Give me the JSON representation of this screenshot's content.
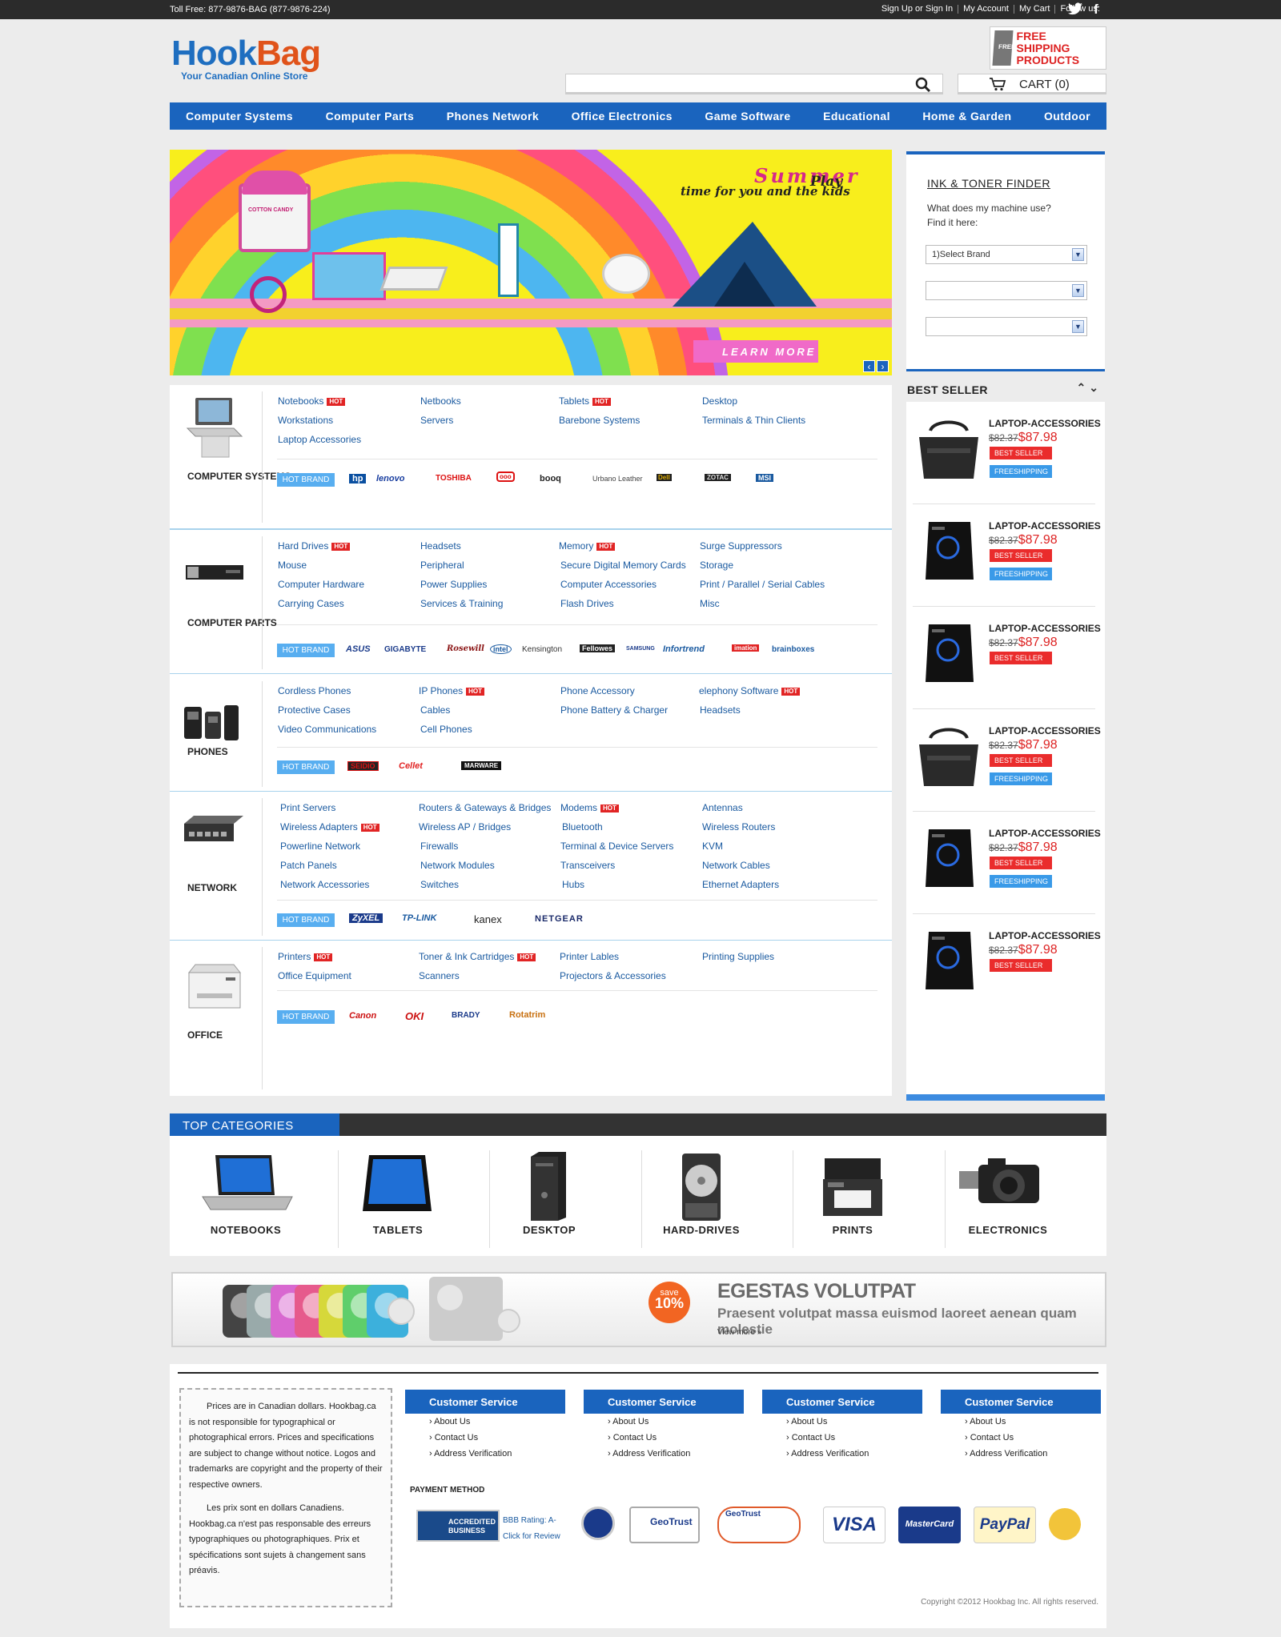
{
  "topbar": {
    "toll_free": "Toll Free: 877-9876-BAG (877-9876-224)",
    "links": [
      "Sign Up or Sign In",
      "My Account",
      "My Cart",
      "Follow us:"
    ],
    "social_icons": [
      "twitter-icon",
      "facebook-icon"
    ]
  },
  "header": {
    "logo_part1": "Hook",
    "logo_part2": "Bag",
    "tagline": "Your Canadian Online Store",
    "free_shipping": "FREE SHIPPING PRODUCTS",
    "free_shipping_box": "FREE",
    "search_placeholder": "",
    "cart_label": "CART (0)"
  },
  "nav": [
    "Computer Systems",
    "Computer Parts",
    "Phones Network",
    "Office Electronics",
    "Game Software",
    "Educational",
    "Home & Garden",
    "Outdoor"
  ],
  "slider": {
    "headline": "Summer",
    "play": "Play",
    "subline": "time for you and the kids",
    "button": "LEARN MORE",
    "cotton_candy_label": "COTTON CANDY"
  },
  "categories": [
    {
      "title": "COMPUTER SYSTEMS",
      "items": [
        {
          "label": "Notebooks",
          "hot": true
        },
        {
          "label": "Netbooks"
        },
        {
          "label": "Tablets",
          "hot": true
        },
        {
          "label": "Desktop"
        },
        {
          "label": "Workstations"
        },
        {
          "label": "Servers"
        },
        {
          "label": "Barebone Systems"
        },
        {
          "label": "Terminals & Thin Clients"
        },
        {
          "label": "Laptop Accessories"
        }
      ],
      "brands": [
        "hp",
        "lenovo",
        "TOSHIBA",
        "ooo",
        "booq",
        "Urbano Leather",
        "Dell",
        "ZOTAC",
        "MSI"
      ]
    },
    {
      "title": "COMPUTER PARTS",
      "items": [
        {
          "label": "Hard Drives",
          "hot": true
        },
        {
          "label": "Headsets"
        },
        {
          "label": "Memory",
          "hot": true
        },
        {
          "label": "Surge Suppressors"
        },
        {
          "label": "Mouse"
        },
        {
          "label": "Peripheral"
        },
        {
          "label": "Secure Digital Memory Cards"
        },
        {
          "label": "Storage"
        },
        {
          "label": "Computer Hardware"
        },
        {
          "label": "Power Supplies"
        },
        {
          "label": "Computer Accessories"
        },
        {
          "label": "Print / Parallel / Serial Cables"
        },
        {
          "label": "Carrying Cases"
        },
        {
          "label": "Services & Training"
        },
        {
          "label": "Flash Drives"
        },
        {
          "label": "Misc"
        }
      ],
      "brands": [
        "ASUS",
        "GIGABYTE",
        "Rosewill",
        "intel",
        "Kensington",
        "Fellowes",
        "SAMSUNG",
        "Infortrend",
        "imation",
        "brainboxes"
      ]
    },
    {
      "title": "PHONES",
      "items": [
        {
          "label": "Cordless Phones"
        },
        {
          "label": "IP Phones",
          "hot": true
        },
        {
          "label": "Phone Accessory"
        },
        {
          "label": "elephony Software",
          "hot": true
        },
        {
          "label": "Protective Cases"
        },
        {
          "label": "Cables"
        },
        {
          "label": "Phone Battery & Charger"
        },
        {
          "label": "Headsets"
        },
        {
          "label": "Video Communications"
        },
        {
          "label": "Cell Phones"
        }
      ],
      "brands": [
        "SEIDIO",
        "Cellet",
        "MARWARE"
      ]
    },
    {
      "title": "NETWORK",
      "items": [
        {
          "label": "Print Servers"
        },
        {
          "label": "Routers & Gateways & Bridges"
        },
        {
          "label": "Modems",
          "hot": true
        },
        {
          "label": "Antennas"
        },
        {
          "label": "Wireless Adapters",
          "hot": true
        },
        {
          "label": "Wireless AP / Bridges"
        },
        {
          "label": "Bluetooth"
        },
        {
          "label": "Wireless Routers"
        },
        {
          "label": "Powerline Network"
        },
        {
          "label": "Firewalls"
        },
        {
          "label": "Terminal & Device Servers"
        },
        {
          "label": "KVM"
        },
        {
          "label": "Patch Panels"
        },
        {
          "label": "Network Modules"
        },
        {
          "label": "Transceivers"
        },
        {
          "label": "Network Cables"
        },
        {
          "label": "Network Accessories"
        },
        {
          "label": "Switches"
        },
        {
          "label": "Hubs"
        },
        {
          "label": "Ethernet Adapters"
        }
      ],
      "brands": [
        "ZyXEL",
        "TP-LINK",
        "kanex",
        "NETGEAR"
      ]
    },
    {
      "title": "OFFICE",
      "items": [
        {
          "label": "Printers",
          "hot": true
        },
        {
          "label": "Toner & Ink Cartridges",
          "hot": true
        },
        {
          "label": "Printer Lables"
        },
        {
          "label": "Printing Supplies"
        },
        {
          "label": "Office Equipment"
        },
        {
          "label": "Scanners"
        },
        {
          "label": "Projectors & Accessories"
        }
      ],
      "brands": [
        "Canon",
        "OKI",
        "BRADY",
        "Rotatrim"
      ]
    }
  ],
  "hot_label": "HOT",
  "hot_brand_label": "HOT BRAND",
  "ink_finder": {
    "title": "INK & TONER FINDER",
    "question": "What does my machine use?",
    "hint": "Find it here:",
    "select1": "1)Select Brand",
    "select2": "",
    "select3": ""
  },
  "best_seller": {
    "title": "BEST SELLER",
    "products": [
      {
        "name": "LAPTOP-ACCESSORIES",
        "old": "$82.37",
        "price": "$87.98",
        "badges": [
          "BEST SELLER",
          "FREESHIPPING"
        ]
      },
      {
        "name": "LAPTOP-ACCESSORIES",
        "old": "$82.37",
        "price": "$87.98",
        "badges": [
          "BEST SELLER",
          "FREESHIPPING"
        ]
      },
      {
        "name": "LAPTOP-ACCESSORIES",
        "old": "$82.37",
        "price": "$87.98",
        "badges": [
          "BEST SELLER"
        ]
      },
      {
        "name": "LAPTOP-ACCESSORIES",
        "old": "$82.37",
        "price": "$87.98",
        "badges": [
          "BEST SELLER",
          "FREESHIPPING"
        ]
      },
      {
        "name": "LAPTOP-ACCESSORIES",
        "old": "$82.37",
        "price": "$87.98",
        "badges": [
          "BEST SELLER",
          "FREESHIPPING"
        ]
      },
      {
        "name": "LAPTOP-ACCESSORIES",
        "old": "$82.37",
        "price": "$87.98",
        "badges": [
          "BEST SELLER"
        ]
      }
    ]
  },
  "top_categories": {
    "title": "TOP CATEGORIES",
    "items": [
      "NOTEBOOKS",
      "TABLETS",
      "DESKTOP",
      "HARD-DRIVES",
      "PRINTS",
      "ELECTRONICS"
    ]
  },
  "promo_banner": {
    "save_top": "save",
    "save_value": "10%",
    "title": "EGESTAS VOLUTPAT",
    "subtitle": "Praesent volutpat massa euismod laoreet aenean  quam molestie",
    "link": "View more  »"
  },
  "footer": {
    "disclaimer_en": "Prices are in Canadian dollars. Hookbag.ca is not responsible for typographical or photographical errors. Prices and specifications are subject to change without notice. Logos and trademarks are copyright and the property of their respective owners.",
    "disclaimer_fr": "Les prix sont en dollars Canadiens. Hookbag.ca n'est pas responsable des erreurs typographiques ou photographiques. Prix et spécifications sont sujets à changement sans préavis.",
    "columns": [
      {
        "title": "Customer Service",
        "links": [
          "› About Us",
          "› Contact Us",
          "› Address Verification"
        ]
      },
      {
        "title": "Customer Service",
        "links": [
          "› About Us",
          "› Contact Us",
          "› Address Verification"
        ]
      },
      {
        "title": "Customer Service",
        "links": [
          "› About Us",
          "› Contact Us",
          "› Address Verification"
        ]
      },
      {
        "title": "Customer Service",
        "links": [
          "› About Us",
          "› Contact Us",
          "› Address Verification"
        ]
      }
    ],
    "payment_title": "PAYMENT METHOD",
    "bbb": {
      "line1": "ACCREDITED",
      "line2": "BUSINESS",
      "rating": "BBB Rating: A-",
      "review": "Click for Review"
    },
    "payment_logos": [
      "VISA",
      "MasterCard",
      "PayPal"
    ],
    "geotrust": "GeoTrust",
    "copyright": "Copyright ©2012 Hookbag Inc. All rights reserved."
  },
  "colors": {
    "brand_blue": "#1a64be",
    "hot_red": "#e12424",
    "price_red": "#dd2222"
  }
}
